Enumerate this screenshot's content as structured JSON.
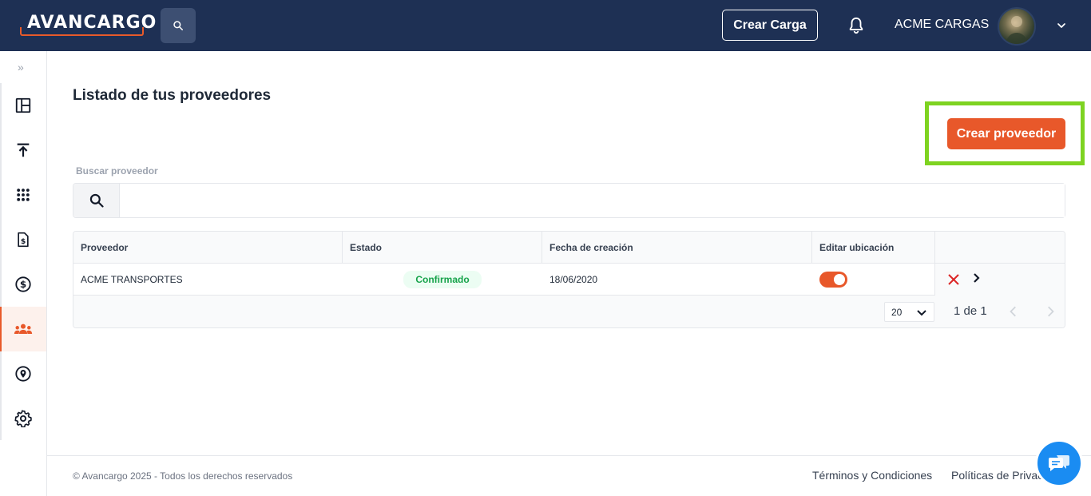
{
  "header": {
    "logo_text": "AVANCARGO",
    "create_load_label": "Crear Carga",
    "company_name": "ACME CARGAS"
  },
  "sidebar": {
    "expand_label": "»",
    "items": [
      {
        "icon": "dashboard-icon",
        "active": false
      },
      {
        "icon": "upload-icon",
        "active": false
      },
      {
        "icon": "grid-dots-icon",
        "active": false
      },
      {
        "icon": "invoice-icon",
        "active": false
      },
      {
        "icon": "dollar-icon",
        "active": false
      },
      {
        "icon": "people-icon",
        "active": true
      },
      {
        "icon": "location-pin-icon",
        "active": false
      },
      {
        "icon": "gear-icon",
        "active": false
      }
    ]
  },
  "main": {
    "title": "Listado de tus proveedores",
    "create_button_label": "Crear proveedor",
    "search_label": "Buscar proveedor",
    "search_value": "",
    "table": {
      "columns": [
        "Proveedor",
        "Estado",
        "Fecha de creación",
        "Editar ubicación"
      ],
      "rows": [
        {
          "provider": "ACME TRANSPORTES",
          "status": "Confirmado",
          "created": "18/06/2020",
          "edit_location": true
        }
      ],
      "rows_per_page": "20",
      "page_info": "1 de 1"
    }
  },
  "footer": {
    "copyright": "© Avancargo 2025 - Todos los derechos reservados",
    "terms": "Términos y Condiciones",
    "privacy": "Políticas de Privacidad"
  },
  "colors": {
    "header_bg": "#1e3054",
    "accent": "#e8582a",
    "highlight": "#7ed321",
    "status_green": "#16a34a",
    "chat": "#1a8cf2"
  }
}
